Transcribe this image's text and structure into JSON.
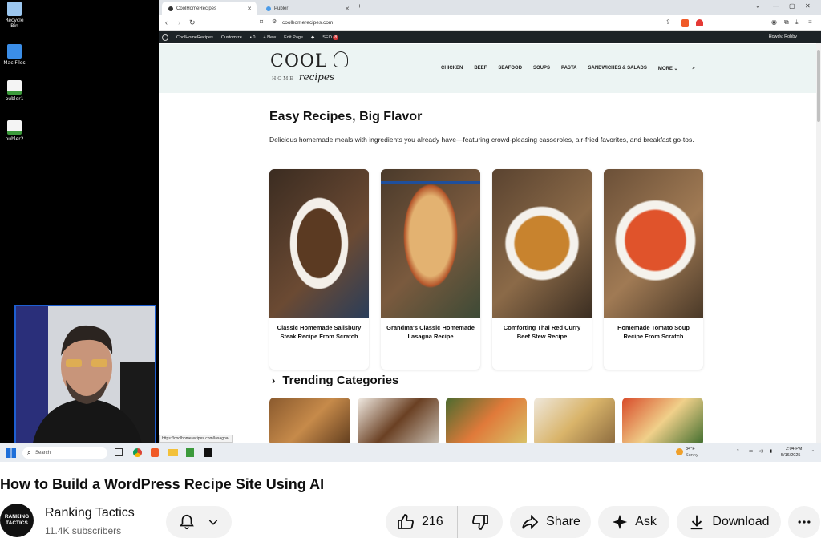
{
  "desktop": {
    "icons": [
      {
        "label": "Recycle Bin"
      },
      {
        "label": "Mac Files"
      },
      {
        "label": "publer1"
      },
      {
        "label": "publer2"
      }
    ]
  },
  "browser": {
    "tabs": [
      {
        "label": "CoolHomeRecipes"
      },
      {
        "label": "Publer"
      }
    ],
    "url": "coolhomerecipes.com",
    "status_url": "https://coolhomerecipes.com/lasagna/"
  },
  "wp_admin_bar": {
    "site_name": "CoolHomeRecipes",
    "customize": "Customize",
    "comments": "0",
    "new": "+ New",
    "edit_page": "Edit Page",
    "seo": "SEO",
    "seo_badge": "8",
    "howdy": "Howdy, Robby"
  },
  "site": {
    "logo": {
      "cool": "COOL",
      "home": "HOME",
      "recipes": "recipes"
    },
    "nav": [
      "CHICKEN",
      "BEEF",
      "SEAFOOD",
      "SOUPS",
      "PASTA",
      "SANDWICHES & SALADS",
      "MORE"
    ],
    "hero_title": "Easy Recipes, Big Flavor",
    "hero_text": "Delicious homemade meals with ingredients you already have—featuring crowd-pleasing casseroles, air-fried favorites, and breakfast go-tos.",
    "cards": [
      {
        "title": "Classic Homemade Salisbury Steak Recipe From Scratch"
      },
      {
        "title": "Grandma's Classic Homemade Lasagna Recipe"
      },
      {
        "title": "Comforting Thai Red Curry Beef Stew Recipe"
      },
      {
        "title": "Homemade Tomato Soup Recipe From Scratch"
      }
    ],
    "trending_title": "Trending Categories"
  },
  "taskbar": {
    "search_placeholder": "Search",
    "weather_temp": "84°F",
    "weather_cond": "Sunny",
    "time": "2:04 PM",
    "date": "5/16/2025"
  },
  "video": {
    "title": "How to Build a WordPress Recipe Site Using AI",
    "channel": "Ranking Tactics",
    "avatar_text": "RANKING TACTICS",
    "subscribers": "11.4K subscribers",
    "likes": "216",
    "share": "Share",
    "ask": "Ask",
    "download": "Download"
  },
  "colors": {
    "accent_blue": "#1e5fd1",
    "site_header_bg": "#ecf4f3",
    "wp_bar": "#1d2327"
  }
}
